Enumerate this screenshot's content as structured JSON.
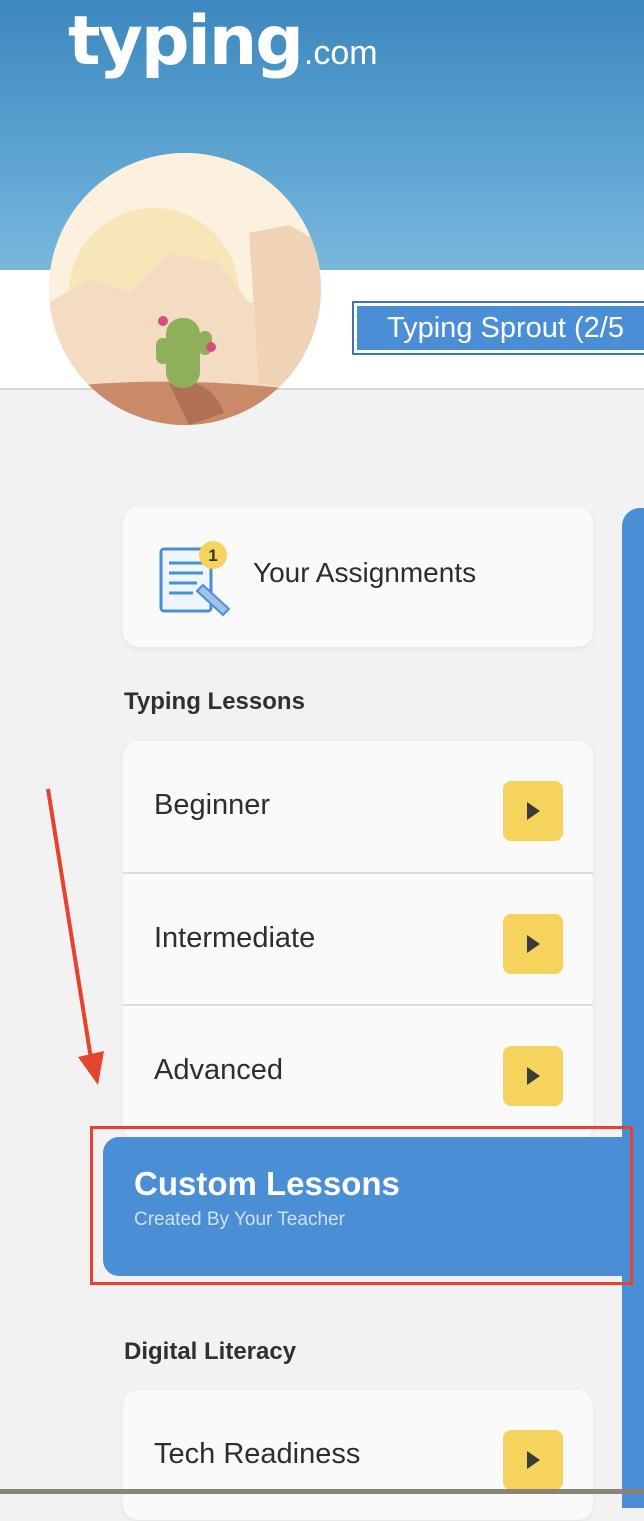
{
  "header": {
    "logo_main": "typing",
    "logo_suffix": ".com",
    "level_badge": "Typing Sprout (2/5"
  },
  "assignments": {
    "label": "Your Assignments",
    "badge_count": "1"
  },
  "typing_lessons": {
    "title": "Typing Lessons",
    "items": [
      {
        "label": "Beginner"
      },
      {
        "label": "Intermediate"
      },
      {
        "label": "Advanced"
      }
    ]
  },
  "custom_lessons": {
    "title": "Custom Lessons",
    "subtitle": "Created By Your Teacher"
  },
  "digital_literacy": {
    "title": "Digital Literacy",
    "items": [
      {
        "label": "Tech Readiness"
      }
    ]
  },
  "colors": {
    "header_blue": "#3d87bf",
    "accent_blue": "#4a8fd5",
    "play_yellow": "#f5d35d",
    "annotation_red": "#e5432d"
  },
  "icons": [
    "assignment-icon",
    "play-icon",
    "annotation-arrow"
  ]
}
